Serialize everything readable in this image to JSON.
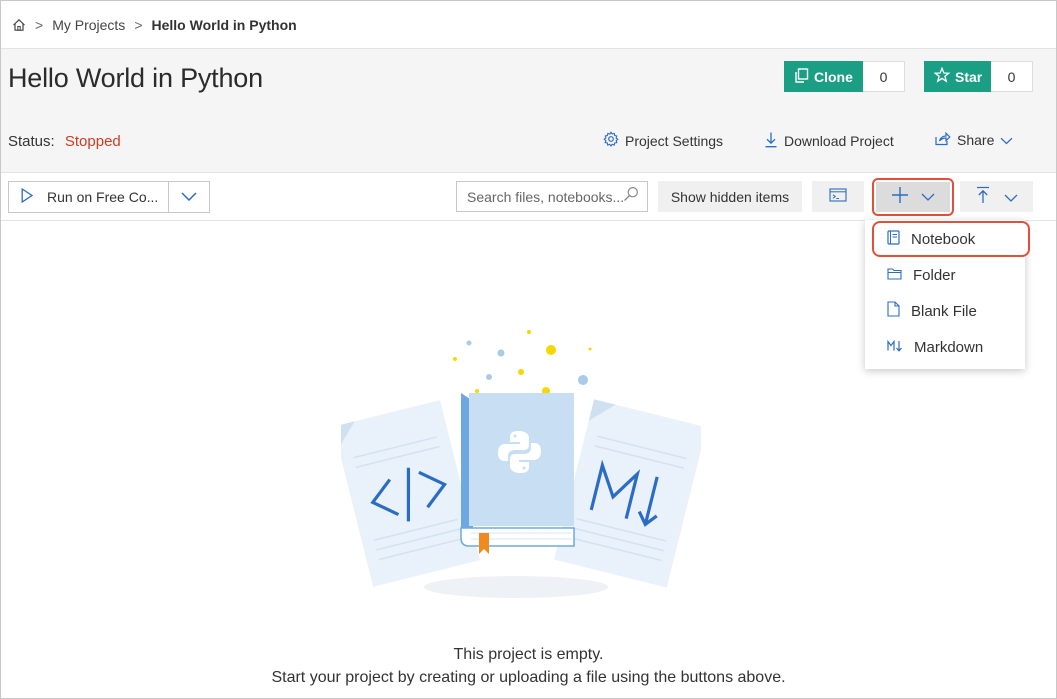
{
  "breadcrumb": {
    "home_icon": "home-icon",
    "sep1": ">",
    "my_projects": "My Projects",
    "sep2": ">",
    "current": "Hello World in Python"
  },
  "header": {
    "title": "Hello World in Python",
    "clone": {
      "label": "Clone",
      "count": "0",
      "icon": "copy-icon"
    },
    "star": {
      "label": "Star",
      "count": "0",
      "icon": "star-icon"
    },
    "status_label": "Status:",
    "status_value": "Stopped",
    "project_settings": "Project Settings",
    "download_project": "Download Project",
    "share": "Share"
  },
  "toolbar": {
    "run_label": "Run on Free Co...",
    "search_placeholder": "Search files, notebooks...",
    "show_hidden": "Show hidden items"
  },
  "new_menu": {
    "items": [
      {
        "label": "Notebook",
        "icon": "notebook-icon"
      },
      {
        "label": "Folder",
        "icon": "folder-icon"
      },
      {
        "label": "Blank File",
        "icon": "file-icon"
      },
      {
        "label": "Markdown",
        "icon": "markdown-icon"
      }
    ]
  },
  "empty_state": {
    "line1": "This project is empty.",
    "line2": "Start your project by creating or uploading a file using the buttons above."
  },
  "colors": {
    "accent_green": "#1a9e84",
    "status_red": "#d13b20",
    "highlight_red": "#e0503a",
    "icon_blue": "#2b6cc4"
  }
}
